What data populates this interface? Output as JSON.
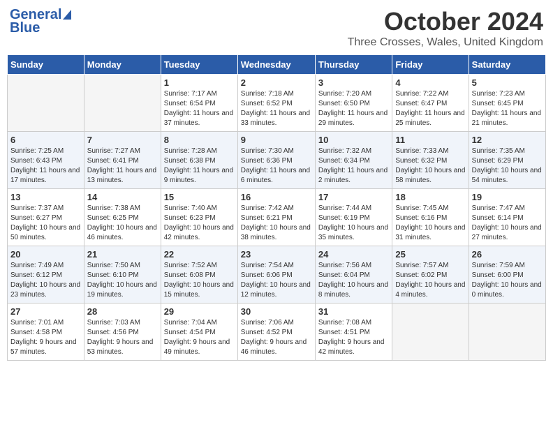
{
  "header": {
    "logo_general": "General",
    "logo_blue": "Blue",
    "month_title": "October 2024",
    "subtitle": "Three Crosses, Wales, United Kingdom"
  },
  "days_of_week": [
    "Sunday",
    "Monday",
    "Tuesday",
    "Wednesday",
    "Thursday",
    "Friday",
    "Saturday"
  ],
  "weeks": [
    {
      "days": [
        {
          "number": "",
          "info": ""
        },
        {
          "number": "",
          "info": ""
        },
        {
          "number": "1",
          "info": "Sunrise: 7:17 AM\nSunset: 6:54 PM\nDaylight: 11 hours and 37 minutes."
        },
        {
          "number": "2",
          "info": "Sunrise: 7:18 AM\nSunset: 6:52 PM\nDaylight: 11 hours and 33 minutes."
        },
        {
          "number": "3",
          "info": "Sunrise: 7:20 AM\nSunset: 6:50 PM\nDaylight: 11 hours and 29 minutes."
        },
        {
          "number": "4",
          "info": "Sunrise: 7:22 AM\nSunset: 6:47 PM\nDaylight: 11 hours and 25 minutes."
        },
        {
          "number": "5",
          "info": "Sunrise: 7:23 AM\nSunset: 6:45 PM\nDaylight: 11 hours and 21 minutes."
        }
      ]
    },
    {
      "days": [
        {
          "number": "6",
          "info": "Sunrise: 7:25 AM\nSunset: 6:43 PM\nDaylight: 11 hours and 17 minutes."
        },
        {
          "number": "7",
          "info": "Sunrise: 7:27 AM\nSunset: 6:41 PM\nDaylight: 11 hours and 13 minutes."
        },
        {
          "number": "8",
          "info": "Sunrise: 7:28 AM\nSunset: 6:38 PM\nDaylight: 11 hours and 9 minutes."
        },
        {
          "number": "9",
          "info": "Sunrise: 7:30 AM\nSunset: 6:36 PM\nDaylight: 11 hours and 6 minutes."
        },
        {
          "number": "10",
          "info": "Sunrise: 7:32 AM\nSunset: 6:34 PM\nDaylight: 11 hours and 2 minutes."
        },
        {
          "number": "11",
          "info": "Sunrise: 7:33 AM\nSunset: 6:32 PM\nDaylight: 10 hours and 58 minutes."
        },
        {
          "number": "12",
          "info": "Sunrise: 7:35 AM\nSunset: 6:29 PM\nDaylight: 10 hours and 54 minutes."
        }
      ]
    },
    {
      "days": [
        {
          "number": "13",
          "info": "Sunrise: 7:37 AM\nSunset: 6:27 PM\nDaylight: 10 hours and 50 minutes."
        },
        {
          "number": "14",
          "info": "Sunrise: 7:38 AM\nSunset: 6:25 PM\nDaylight: 10 hours and 46 minutes."
        },
        {
          "number": "15",
          "info": "Sunrise: 7:40 AM\nSunset: 6:23 PM\nDaylight: 10 hours and 42 minutes."
        },
        {
          "number": "16",
          "info": "Sunrise: 7:42 AM\nSunset: 6:21 PM\nDaylight: 10 hours and 38 minutes."
        },
        {
          "number": "17",
          "info": "Sunrise: 7:44 AM\nSunset: 6:19 PM\nDaylight: 10 hours and 35 minutes."
        },
        {
          "number": "18",
          "info": "Sunrise: 7:45 AM\nSunset: 6:16 PM\nDaylight: 10 hours and 31 minutes."
        },
        {
          "number": "19",
          "info": "Sunrise: 7:47 AM\nSunset: 6:14 PM\nDaylight: 10 hours and 27 minutes."
        }
      ]
    },
    {
      "days": [
        {
          "number": "20",
          "info": "Sunrise: 7:49 AM\nSunset: 6:12 PM\nDaylight: 10 hours and 23 minutes."
        },
        {
          "number": "21",
          "info": "Sunrise: 7:50 AM\nSunset: 6:10 PM\nDaylight: 10 hours and 19 minutes."
        },
        {
          "number": "22",
          "info": "Sunrise: 7:52 AM\nSunset: 6:08 PM\nDaylight: 10 hours and 15 minutes."
        },
        {
          "number": "23",
          "info": "Sunrise: 7:54 AM\nSunset: 6:06 PM\nDaylight: 10 hours and 12 minutes."
        },
        {
          "number": "24",
          "info": "Sunrise: 7:56 AM\nSunset: 6:04 PM\nDaylight: 10 hours and 8 minutes."
        },
        {
          "number": "25",
          "info": "Sunrise: 7:57 AM\nSunset: 6:02 PM\nDaylight: 10 hours and 4 minutes."
        },
        {
          "number": "26",
          "info": "Sunrise: 7:59 AM\nSunset: 6:00 PM\nDaylight: 10 hours and 0 minutes."
        }
      ]
    },
    {
      "days": [
        {
          "number": "27",
          "info": "Sunrise: 7:01 AM\nSunset: 4:58 PM\nDaylight: 9 hours and 57 minutes."
        },
        {
          "number": "28",
          "info": "Sunrise: 7:03 AM\nSunset: 4:56 PM\nDaylight: 9 hours and 53 minutes."
        },
        {
          "number": "29",
          "info": "Sunrise: 7:04 AM\nSunset: 4:54 PM\nDaylight: 9 hours and 49 minutes."
        },
        {
          "number": "30",
          "info": "Sunrise: 7:06 AM\nSunset: 4:52 PM\nDaylight: 9 hours and 46 minutes."
        },
        {
          "number": "31",
          "info": "Sunrise: 7:08 AM\nSunset: 4:51 PM\nDaylight: 9 hours and 42 minutes."
        },
        {
          "number": "",
          "info": ""
        },
        {
          "number": "",
          "info": ""
        }
      ]
    }
  ]
}
